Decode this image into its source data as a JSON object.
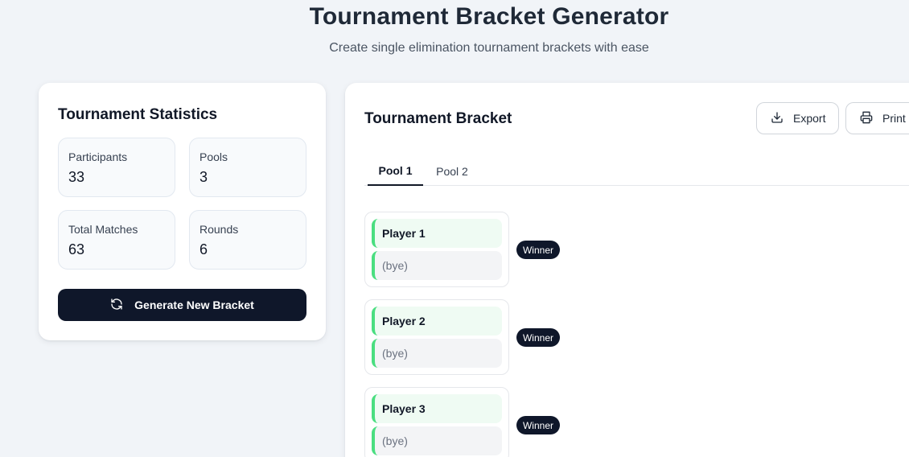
{
  "header": {
    "title": "Tournament Bracket Generator",
    "subtitle": "Create single elimination tournament brackets with ease"
  },
  "stats": {
    "title": "Tournament Statistics",
    "items": [
      {
        "label": "Participants",
        "value": "33"
      },
      {
        "label": "Pools",
        "value": "3"
      },
      {
        "label": "Total Matches",
        "value": "63"
      },
      {
        "label": "Rounds",
        "value": "6"
      }
    ],
    "generate_label": "Generate New Bracket"
  },
  "bracket": {
    "title": "Tournament Bracket",
    "export_label": "Export",
    "print_label": "Print",
    "tabs": [
      {
        "label": "Pool 1",
        "active": true
      },
      {
        "label": "Pool 2",
        "active": false
      }
    ],
    "matches": [
      {
        "player_top": "Player 1",
        "player_bottom": "(bye)",
        "badge": "Winner"
      },
      {
        "player_top": "Player 2",
        "player_bottom": "(bye)",
        "badge": "Winner"
      },
      {
        "player_top": "Player 3",
        "player_bottom": "(bye)",
        "badge": "Winner"
      }
    ]
  },
  "icons": {
    "generate": "refresh-icon",
    "export": "download-icon",
    "print": "printer-icon"
  },
  "colors": {
    "page_background": "#f1f4f8",
    "primary_dark": "#0f172a",
    "winner_accent": "#4ade80",
    "winner_slot_background": "#effbf3"
  }
}
